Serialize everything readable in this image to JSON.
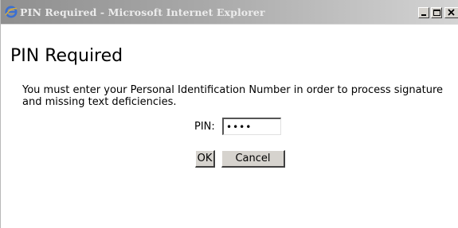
{
  "window": {
    "title": "PIN Required - Microsoft Internet Explorer",
    "title_icon": "ie-icon",
    "controls": [
      "minimize-icon",
      "maximize-icon",
      "close-icon"
    ]
  },
  "content": {
    "heading": "PIN Required",
    "message": "You must enter your Personal Identification Number in order to process signature and missing text deficiencies.",
    "pin_label": "PIN:",
    "pin_value": "••••",
    "ok_label": "OK",
    "cancel_label": "Cancel"
  },
  "colors": {
    "titlebar_inactive_start": "#8f8f8f",
    "titlebar_inactive_end": "#d4d4d4",
    "button_face": "#d6d3ce"
  }
}
